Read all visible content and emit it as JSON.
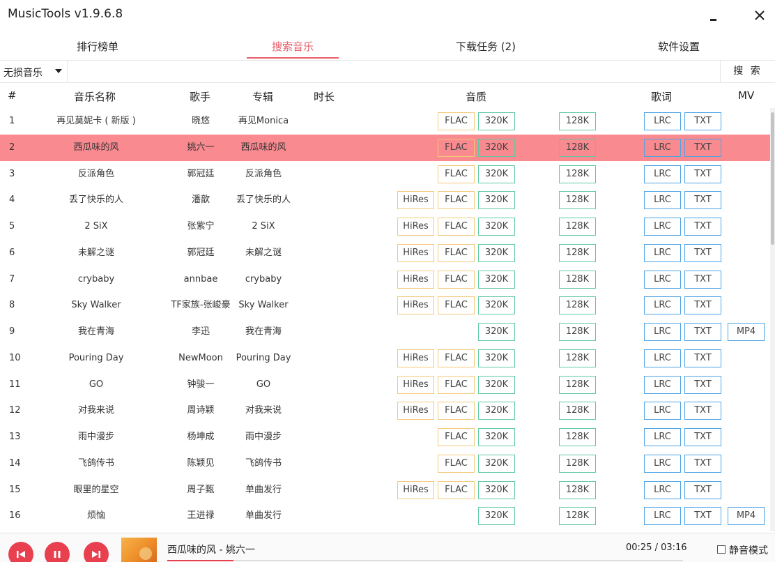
{
  "window": {
    "title": "MusicTools v1.9.6.8"
  },
  "tabs": [
    {
      "label": "排行榜单"
    },
    {
      "label": "搜索音乐"
    },
    {
      "label": "下载任务 (2)"
    },
    {
      "label": "软件设置"
    }
  ],
  "active_tab": 1,
  "search": {
    "source": "无损音乐",
    "query": "",
    "button_label": "搜 索"
  },
  "columns": {
    "num": "#",
    "name": "音乐名称",
    "artist": "歌手",
    "album": "专辑",
    "duration": "时长",
    "quality": "音质",
    "lyrics": "歌词",
    "mv": "MV"
  },
  "rows": [
    {
      "num": "1",
      "name": "再见莫妮卡 ( 新版 )",
      "artist": "晓悠",
      "album": "再见Monica",
      "hires": "",
      "flac": "FLAC",
      "q320": "320K",
      "q128": "128K",
      "lrc": "LRC",
      "txt": "TXT",
      "mv": ""
    },
    {
      "num": "2",
      "name": "西瓜味的风",
      "artist": "姚六一",
      "album": "西瓜味的风",
      "hires": "",
      "flac": "FLAC",
      "q320": "320K",
      "q128": "128K",
      "lrc": "LRC",
      "txt": "TXT",
      "mv": "",
      "selected": true
    },
    {
      "num": "3",
      "name": "反派角色",
      "artist": "郭冠廷",
      "album": "反派角色",
      "hires": "",
      "flac": "FLAC",
      "q320": "320K",
      "q128": "128K",
      "lrc": "LRC",
      "txt": "TXT",
      "mv": ""
    },
    {
      "num": "4",
      "name": "丢了快乐的人",
      "artist": "潘歆",
      "album": "丢了快乐的人",
      "hires": "HiRes",
      "flac": "FLAC",
      "q320": "320K",
      "q128": "128K",
      "lrc": "LRC",
      "txt": "TXT",
      "mv": ""
    },
    {
      "num": "5",
      "name": "2 SiX",
      "artist": "张紫宁",
      "album": "2 SiX",
      "hires": "HiRes",
      "flac": "FLAC",
      "q320": "320K",
      "q128": "128K",
      "lrc": "LRC",
      "txt": "TXT",
      "mv": ""
    },
    {
      "num": "6",
      "name": "未解之谜",
      "artist": "郭冠廷",
      "album": "未解之谜",
      "hires": "HiRes",
      "flac": "FLAC",
      "q320": "320K",
      "q128": "128K",
      "lrc": "LRC",
      "txt": "TXT",
      "mv": ""
    },
    {
      "num": "7",
      "name": "crybaby",
      "artist": "annbae",
      "album": "crybaby",
      "hires": "HiRes",
      "flac": "FLAC",
      "q320": "320K",
      "q128": "128K",
      "lrc": "LRC",
      "txt": "TXT",
      "mv": ""
    },
    {
      "num": "8",
      "name": "Sky Walker",
      "artist": "TF家族-张峻豪",
      "album": "Sky Walker",
      "hires": "HiRes",
      "flac": "FLAC",
      "q320": "320K",
      "q128": "128K",
      "lrc": "LRC",
      "txt": "TXT",
      "mv": ""
    },
    {
      "num": "9",
      "name": "我在青海",
      "artist": "李迅",
      "album": "我在青海",
      "hires": "",
      "flac": "",
      "q320": "320K",
      "q128": "128K",
      "lrc": "LRC",
      "txt": "TXT",
      "mv": "MP4"
    },
    {
      "num": "10",
      "name": "Pouring Day",
      "artist": "NewMoon",
      "album": "Pouring Day",
      "hires": "HiRes",
      "flac": "FLAC",
      "q320": "320K",
      "q128": "128K",
      "lrc": "LRC",
      "txt": "TXT",
      "mv": ""
    },
    {
      "num": "11",
      "name": "GO",
      "artist": "钟骏一",
      "album": "GO",
      "hires": "HiRes",
      "flac": "FLAC",
      "q320": "320K",
      "q128": "128K",
      "lrc": "LRC",
      "txt": "TXT",
      "mv": ""
    },
    {
      "num": "12",
      "name": "对我来说",
      "artist": "周诗颖",
      "album": "对我来说",
      "hires": "HiRes",
      "flac": "FLAC",
      "q320": "320K",
      "q128": "128K",
      "lrc": "LRC",
      "txt": "TXT",
      "mv": ""
    },
    {
      "num": "13",
      "name": "雨中漫步",
      "artist": "杨坤成",
      "album": "雨中漫步",
      "hires": "",
      "flac": "FLAC",
      "q320": "320K",
      "q128": "128K",
      "lrc": "LRC",
      "txt": "TXT",
      "mv": ""
    },
    {
      "num": "14",
      "name": "飞鸽传书",
      "artist": "陈颖见",
      "album": "飞鸽传书",
      "hires": "",
      "flac": "FLAC",
      "q320": "320K",
      "q128": "128K",
      "lrc": "LRC",
      "txt": "TXT",
      "mv": ""
    },
    {
      "num": "15",
      "name": "眼里的星空",
      "artist": "周子甄",
      "album": "单曲发行",
      "hires": "HiRes",
      "flac": "FLAC",
      "q320": "320K",
      "q128": "128K",
      "lrc": "LRC",
      "txt": "TXT",
      "mv": ""
    },
    {
      "num": "16",
      "name": "烦恼",
      "artist": "王进禄",
      "album": "单曲发行",
      "hires": "",
      "flac": "",
      "q320": "320K",
      "q128": "128K",
      "lrc": "LRC",
      "txt": "TXT",
      "mv": "MP4"
    }
  ],
  "player": {
    "now_playing": "西瓜味的风 - 姚六一",
    "time": "00:25 / 03:16",
    "progress": 0.128,
    "mute_label": "静音模式",
    "mute_checked": false
  },
  "colors": {
    "accent": "#e85d6a",
    "selected_row": "#f98a90",
    "hires_border": "#f5c878",
    "kbps_border": "#5fc9a2",
    "lyric_border": "#4da3e6",
    "player_button": "#e8404f"
  }
}
